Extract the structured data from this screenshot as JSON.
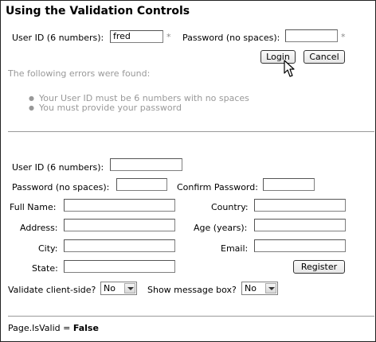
{
  "page": {
    "title": "Using the Validation Controls"
  },
  "login": {
    "userid_label": "User ID (6 numbers):",
    "userid_value": "fred",
    "required_marker": "*",
    "password_label": "Password (no spaces):",
    "password_value": "",
    "login_button": "Login",
    "cancel_button": "Cancel"
  },
  "summary": {
    "header": "The following errors were found:",
    "errors": [
      "Your User ID must be 6 numbers with no spaces",
      "You must provide your password"
    ]
  },
  "register": {
    "userid_label": "User ID (6 numbers):",
    "password_label": "Password (no spaces):",
    "confirm_label": "Confirm Password:",
    "fullname_label": "Full Name:",
    "country_label": "Country:",
    "address_label": "Address:",
    "age_label": "Age (years):",
    "city_label": "City:",
    "email_label": "Email:",
    "state_label": "State:",
    "register_button": "Register"
  },
  "options": {
    "client_side_label": "Validate client-side?",
    "client_side_value": "No",
    "message_box_label": "Show message box?",
    "message_box_value": "No"
  },
  "status": {
    "label": "Page.IsValid =",
    "value": "False"
  }
}
